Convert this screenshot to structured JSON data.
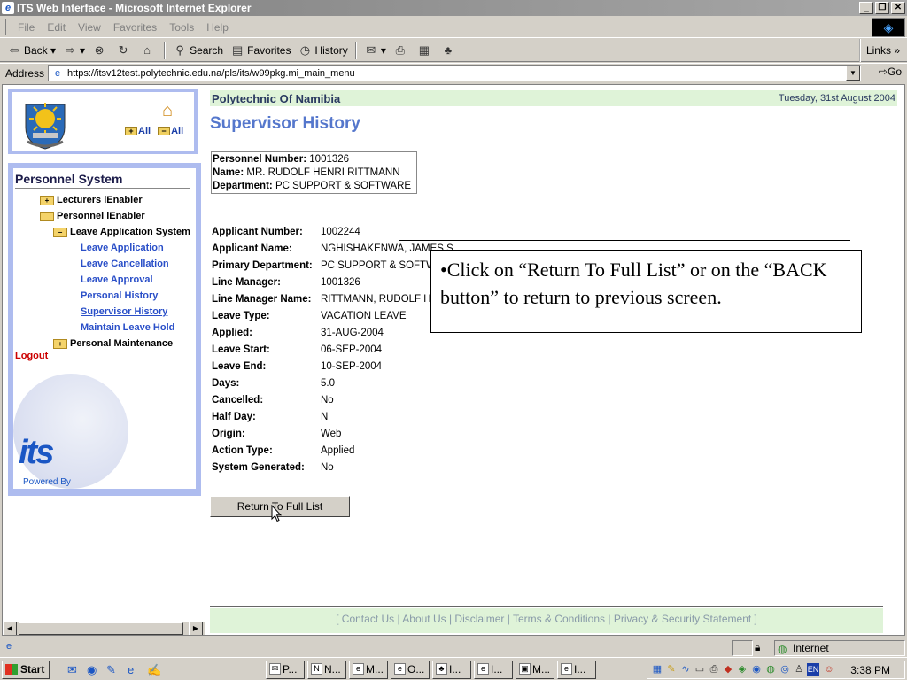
{
  "window": {
    "title": "ITS Web Interface - Microsoft Internet Explorer"
  },
  "menubar": [
    "File",
    "Edit",
    "View",
    "Favorites",
    "Tools",
    "Help"
  ],
  "toolbar": {
    "back": "Back",
    "search": "Search",
    "favorites": "Favorites",
    "history": "History",
    "links": "Links"
  },
  "address": {
    "label": "Address",
    "url": "https://itsv12test.polytechnic.edu.na/pls/its/w99pkg.mi_main_menu",
    "go": "Go"
  },
  "left": {
    "expand_all": "All",
    "collapse_all": "All",
    "nav_title": "Personnel System",
    "items": [
      {
        "label": "Lecturers iEnabler",
        "type": "folder-plus"
      },
      {
        "label": "Personnel iEnabler",
        "type": "folder-open"
      },
      {
        "label": "Leave Application System",
        "type": "folder-minus"
      },
      {
        "label": "Leave Application",
        "type": "link"
      },
      {
        "label": "Leave Cancellation",
        "type": "link"
      },
      {
        "label": "Leave Approval",
        "type": "link"
      },
      {
        "label": "Personal History",
        "type": "link"
      },
      {
        "label": "Supervisor History",
        "type": "link-active"
      },
      {
        "label": "Maintain Leave Hold",
        "type": "link"
      },
      {
        "label": "Personal Maintenance",
        "type": "folder-plus"
      }
    ],
    "logout": "Logout",
    "its_logo": "its",
    "powered_by": "Powered By"
  },
  "main": {
    "org_name": "Polytechnic Of Namibia",
    "date": "Tuesday, 31st August 2004",
    "page_title": "Supervisor History",
    "person": {
      "number_label": "Personnel Number:",
      "number": "1001326",
      "name_label": "Name:",
      "name": "MR. RUDOLF HENRI RITTMANN",
      "dept_label": "Department:",
      "dept": "PC SUPPORT & SOFTWARE"
    },
    "details": [
      {
        "label": "Applicant Number:",
        "value": "1002244"
      },
      {
        "label": "Applicant Name:",
        "value": "NGHISHAKENWA, JAMES S"
      },
      {
        "label": "Primary Department:",
        "value": "PC SUPPORT & SOFTWARE"
      },
      {
        "label": "Line Manager:",
        "value": "1001326"
      },
      {
        "label": "Line Manager Name:",
        "value": "RITTMANN, RUDOLF HENRI"
      },
      {
        "label": "Leave Type:",
        "value": "VACATION LEAVE"
      },
      {
        "label": "Applied:",
        "value": "31-AUG-2004"
      },
      {
        "label": "Leave Start:",
        "value": "06-SEP-2004"
      },
      {
        "label": "Leave End:",
        "value": "10-SEP-2004"
      },
      {
        "label": "Days:",
        "value": "5.0"
      },
      {
        "label": "Cancelled:",
        "value": "No"
      },
      {
        "label": "Half Day:",
        "value": "N"
      },
      {
        "label": "Origin:",
        "value": "Web"
      },
      {
        "label": "Action Type:",
        "value": "Applied"
      },
      {
        "label": "System Generated:",
        "value": "No"
      }
    ],
    "return_button": "Return To Full List",
    "footer": "[ Contact Us | About Us | Disclaimer | Terms & Conditions | Privacy & Security Statement ]"
  },
  "callout": {
    "text": "•Click on “Return To Full List” or on the “BACK button” to return to previous screen."
  },
  "status": {
    "zone": "Internet"
  },
  "taskbar": {
    "start": "Start",
    "tasks": [
      "P...",
      "N...",
      "M...",
      "O...",
      "I...",
      "I...",
      "M...",
      "I..."
    ],
    "clock": "3:38 PM"
  }
}
